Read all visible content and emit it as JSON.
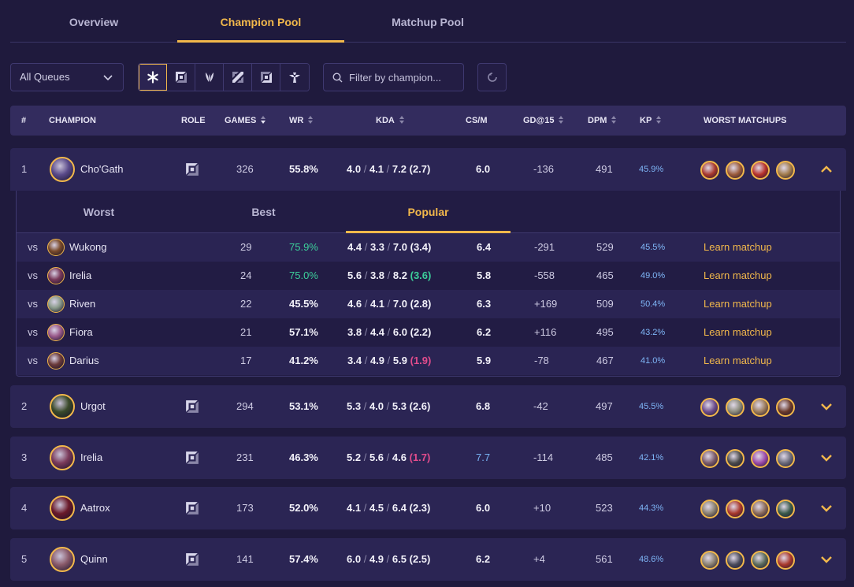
{
  "tabs": [
    "Overview",
    "Champion Pool",
    "Matchup Pool"
  ],
  "active_tab": 1,
  "filters": {
    "queue": "All Queues",
    "search_placeholder": "Filter by champion...",
    "roles": [
      "all-roles-icon",
      "top-icon",
      "jungle-icon",
      "mid-icon",
      "bot-icon",
      "support-icon"
    ]
  },
  "columns": {
    "rank": "#",
    "champion": "CHAMPION",
    "role": "ROLE",
    "games": "GAMES",
    "wr": "WR",
    "kda": "KDA",
    "csm": "CS/M",
    "gd15": "GD@15",
    "dpm": "DPM",
    "kp": "KP",
    "worst": "WORST MATCHUPS"
  },
  "colors": {
    "accent": "#f2b84b",
    "green": "#3ccf9a",
    "pink": "#e24c8c",
    "blue": "#79b4f5"
  },
  "champions": [
    {
      "rank": "1",
      "name": "Cho'Gath",
      "games": "326",
      "wr": "55.8%",
      "k": "4.0",
      "d": "4.1",
      "a": "7.2",
      "ratio": "(2.7)",
      "csm": "6.0",
      "gd15": "-136",
      "dpm": "491",
      "kp": "45.9%",
      "avatar_color": "#5a4a8a",
      "matchups": [
        "#a8382c",
        "#9a5a3a",
        "#b8322a",
        "#a07a4a"
      ]
    },
    {
      "rank": "2",
      "name": "Urgot",
      "games": "294",
      "wr": "53.1%",
      "k": "5.3",
      "d": "4.0",
      "a": "5.3",
      "ratio": "(2.6)",
      "csm": "6.8",
      "gd15": "-42",
      "dpm": "497",
      "kp": "45.5%",
      "avatar_color": "#3a4a2a",
      "matchups": [
        "#6a4a8a",
        "#8a8a7a",
        "#9a7a5a",
        "#6a3a2a"
      ]
    },
    {
      "rank": "3",
      "name": "Irelia",
      "games": "231",
      "wr": "46.3%",
      "k": "5.2",
      "d": "5.6",
      "a": "4.6",
      "ratio": "(1.7)",
      "csm": "7.7",
      "gd15": "-114",
      "dpm": "485",
      "kp": "42.1%",
      "avatar_color": "#7a3a5a",
      "matchups": [
        "#7a5a6a",
        "#4a4a4a",
        "#9a4aa8",
        "#6a6a7a"
      ]
    },
    {
      "rank": "4",
      "name": "Aatrox",
      "games": "173",
      "wr": "52.0%",
      "k": "4.1",
      "d": "4.5",
      "a": "6.4",
      "ratio": "(2.3)",
      "csm": "6.0",
      "gd15": "+10",
      "dpm": "523",
      "kp": "44.3%",
      "avatar_color": "#6a1a2a",
      "matchups": [
        "#8a8070",
        "#a8382c",
        "#8a6a5a",
        "#3a5a4a"
      ]
    },
    {
      "rank": "5",
      "name": "Quinn",
      "games": "141",
      "wr": "57.4%",
      "k": "6.0",
      "d": "4.9",
      "a": "6.5",
      "ratio": "(2.5)",
      "csm": "6.2",
      "gd15": "+4",
      "dpm": "561",
      "kp": "48.6%",
      "avatar_color": "#8a5a6a",
      "matchups": [
        "#8a8070",
        "#4a4a5a",
        "#5a6a5a",
        "#a8382c"
      ]
    }
  ],
  "expanded": {
    "subtabs": [
      "Worst",
      "Best",
      "Popular"
    ],
    "active_subtab": 2,
    "vs_label": "vs",
    "learn_label": "Learn matchup",
    "rows": [
      {
        "name": "Wukong",
        "games": "29",
        "wr": "75.9%",
        "k": "4.4",
        "d": "3.3",
        "a": "7.0",
        "ratio": "(3.4)",
        "csm": "6.4",
        "gd15": "-291",
        "dpm": "529",
        "kp": "45.5%",
        "avatar_color": "#7a4a2a"
      },
      {
        "name": "Irelia",
        "games": "24",
        "wr": "75.0%",
        "k": "5.6",
        "d": "3.8",
        "a": "8.2",
        "ratio": "(3.6)",
        "csm": "5.8",
        "gd15": "-558",
        "dpm": "465",
        "kp": "49.0%",
        "avatar_color": "#7a3a5a"
      },
      {
        "name": "Riven",
        "games": "22",
        "wr": "45.5%",
        "k": "4.6",
        "d": "4.1",
        "a": "7.0",
        "ratio": "(2.8)",
        "csm": "6.3",
        "gd15": "+169",
        "dpm": "509",
        "kp": "50.4%",
        "avatar_color": "#8a9a8a"
      },
      {
        "name": "Fiora",
        "games": "21",
        "wr": "57.1%",
        "k": "3.8",
        "d": "4.4",
        "a": "6.0",
        "ratio": "(2.2)",
        "csm": "6.2",
        "gd15": "+116",
        "dpm": "495",
        "kp": "43.2%",
        "avatar_color": "#9a5a8a"
      },
      {
        "name": "Darius",
        "games": "17",
        "wr": "41.2%",
        "k": "3.4",
        "d": "4.9",
        "a": "5.9",
        "ratio": "(1.9)",
        "csm": "5.9",
        "gd15": "-78",
        "dpm": "467",
        "kp": "41.0%",
        "avatar_color": "#6a3a3a"
      }
    ]
  }
}
